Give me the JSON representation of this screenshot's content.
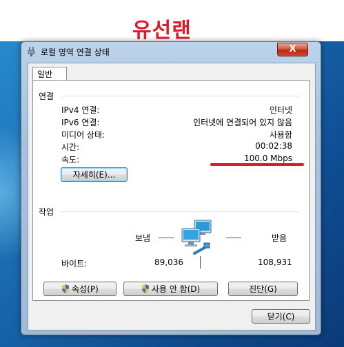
{
  "annotation": {
    "title": "유선랜"
  },
  "window": {
    "title": "로컬 영역 연결 상태",
    "close_label": "X",
    "tab_label": "일반",
    "connection": {
      "group_label": "연결",
      "rows": [
        {
          "label": "IPv4 연결:",
          "value": "인터넷"
        },
        {
          "label": "IPv6 연결:",
          "value": "인터넷에 연결되어 있지 않음"
        },
        {
          "label": "미디어 상태:",
          "value": "사용함"
        },
        {
          "label": "시간:",
          "value": "00:02:38"
        },
        {
          "label": "속도:",
          "value": "100.0 Mbps"
        }
      ],
      "details_button": "자세히(E)..."
    },
    "activity": {
      "group_label": "작업",
      "sent_label": "보냄",
      "received_label": "받음",
      "bytes_label": "바이트:",
      "bytes_sent": "89,036",
      "bytes_received": "108,931"
    },
    "buttons": {
      "properties": "속성(P)",
      "disable": "사용 안 함(D)",
      "diagnose": "진단(G)",
      "close": "닫기(C)"
    }
  },
  "colors": {
    "annotation_red": "#e0182a",
    "desktop_blue": "#1b6fb3"
  }
}
